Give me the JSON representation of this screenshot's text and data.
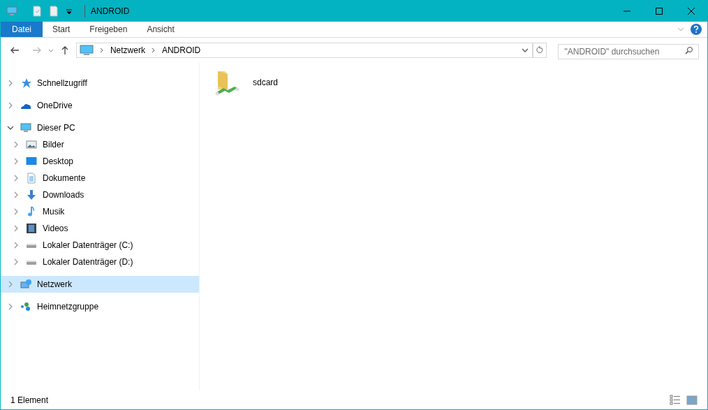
{
  "window": {
    "title": "ANDROID"
  },
  "ribbon_tabs": [
    {
      "label": "Datei",
      "kind": "file"
    },
    {
      "label": "Start",
      "kind": "tab"
    },
    {
      "label": "Freigeben",
      "kind": "tab"
    },
    {
      "label": "Ansicht",
      "kind": "tab"
    }
  ],
  "address_bar": {
    "crumbs": [
      "Netzwerk",
      "ANDROID"
    ]
  },
  "search": {
    "placeholder": "\"ANDROID\" durchsuchen"
  },
  "navigation_tree": [
    {
      "label": "Schnellzugriff",
      "kind": "star",
      "expanded": false,
      "selected": false
    },
    {
      "label": "OneDrive",
      "kind": "cloud",
      "expanded": false,
      "selected": false
    },
    {
      "label": "Dieser PC",
      "kind": "pc",
      "expanded": true,
      "selected": false,
      "children": [
        {
          "label": "Bilder",
          "kind": "pictures",
          "expanded": false,
          "selected": false
        },
        {
          "label": "Desktop",
          "kind": "desktop",
          "expanded": false,
          "selected": false
        },
        {
          "label": "Dokumente",
          "kind": "document",
          "expanded": false,
          "selected": false
        },
        {
          "label": "Downloads",
          "kind": "download",
          "expanded": false,
          "selected": false
        },
        {
          "label": "Musik",
          "kind": "music",
          "expanded": false,
          "selected": false
        },
        {
          "label": "Videos",
          "kind": "video",
          "expanded": false,
          "selected": false
        },
        {
          "label": "Lokaler Datenträger (C:)",
          "kind": "drive",
          "expanded": false,
          "selected": false
        },
        {
          "label": "Lokaler Datenträger (D:)",
          "kind": "drive",
          "expanded": false,
          "selected": false
        }
      ]
    },
    {
      "label": "Netzwerk",
      "kind": "network",
      "expanded": false,
      "selected": true
    },
    {
      "label": "Heimnetzgruppe",
      "kind": "homegroup",
      "expanded": false,
      "selected": false
    }
  ],
  "items": [
    {
      "name": "sdcard"
    }
  ],
  "status_bar": {
    "text": "1 Element"
  }
}
